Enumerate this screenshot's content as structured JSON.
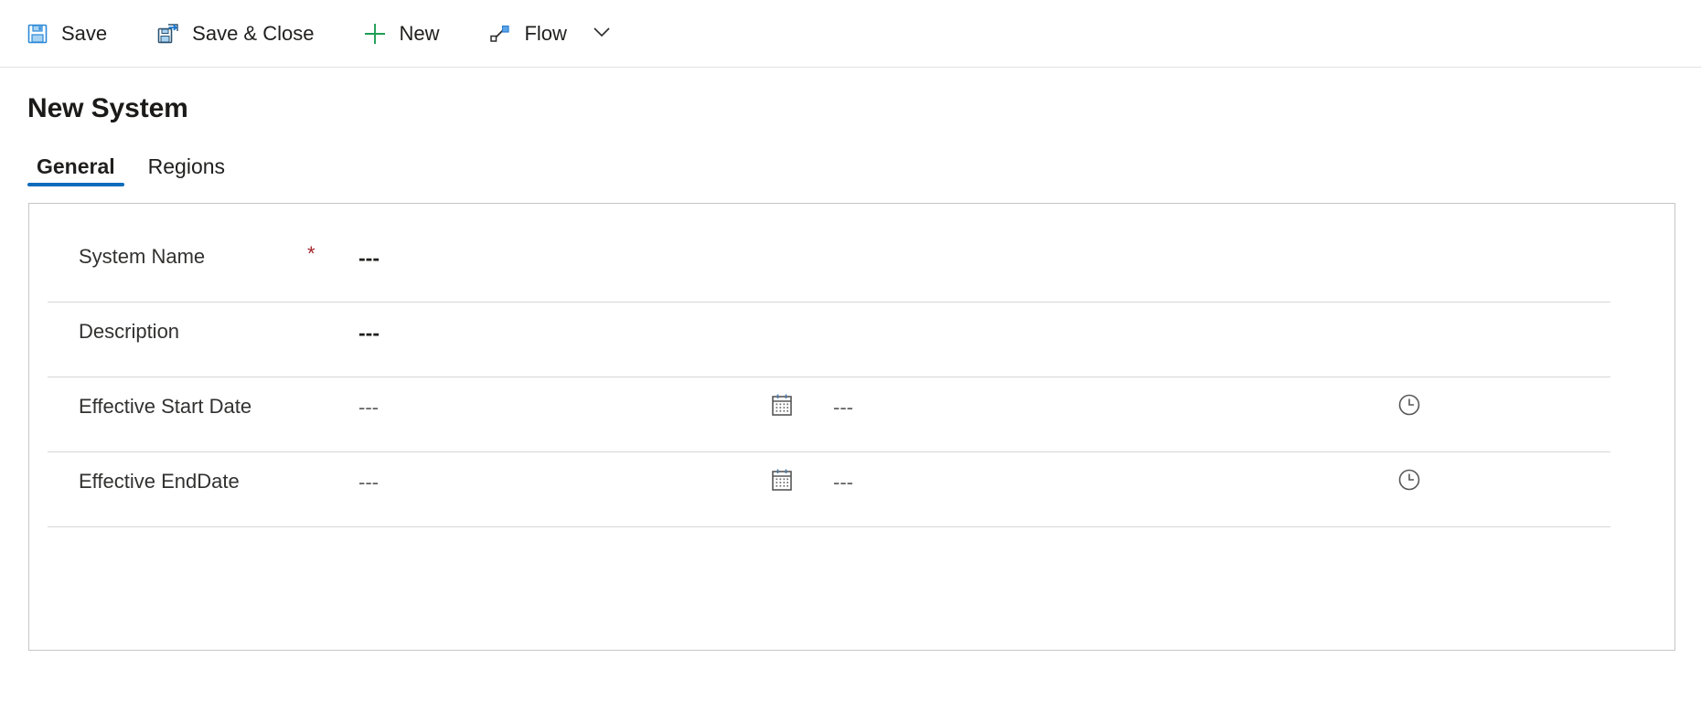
{
  "command_bar": {
    "buttons": [
      {
        "id": "save",
        "label": "Save",
        "icon": "save-icon"
      },
      {
        "id": "save-close",
        "label": "Save & Close",
        "icon": "save-and-close-icon"
      },
      {
        "id": "new",
        "label": "New",
        "icon": "plus-icon"
      },
      {
        "id": "flow",
        "label": "Flow",
        "icon": "flow-icon"
      }
    ],
    "overflow_icon": "chevron-down-icon"
  },
  "page": {
    "title": "New System"
  },
  "tabs": [
    {
      "id": "general",
      "label": "General",
      "active": true
    },
    {
      "id": "regions",
      "label": "Regions",
      "active": false
    }
  ],
  "form": {
    "fields": [
      {
        "id": "system-name",
        "label": "System Name",
        "required": true,
        "required_marker": "*",
        "value": "---",
        "type": "text"
      },
      {
        "id": "description",
        "label": "Description",
        "required": false,
        "required_marker": "",
        "value": "---",
        "type": "text"
      },
      {
        "id": "effective-start-date",
        "label": "Effective Start Date",
        "required": false,
        "required_marker": "",
        "date_value": "---",
        "time_value": "---",
        "date_icon": "calendar-icon",
        "time_icon": "clock-icon",
        "type": "datetime"
      },
      {
        "id": "effective-end-date",
        "label": "Effective EndDate",
        "required": false,
        "required_marker": "",
        "date_value": "---",
        "time_value": "---",
        "date_icon": "calendar-icon",
        "time_icon": "clock-icon",
        "type": "datetime"
      }
    ]
  },
  "colors": {
    "accent": "#0f6cbd",
    "required": "#a4262c",
    "new_icon": "#1d9e54",
    "save_icon": "#2b88d8",
    "text": "#201f1e",
    "border": "#c8c6c4",
    "divider": "#d6d6d6"
  }
}
